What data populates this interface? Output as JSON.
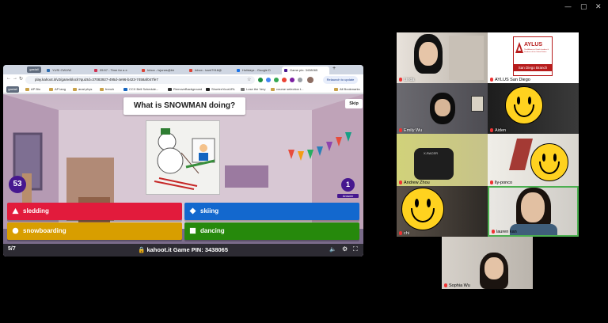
{
  "window_controls": {
    "minimize": "—",
    "maximize": "▢",
    "close": "✕"
  },
  "browser": {
    "profile_badge": "gastail",
    "tabs": [
      {
        "label": "YUSI CWJ/W",
        "color": "#2b6cb0"
      },
      {
        "label": "05:57 - Time for a e",
        "color": "#d03050"
      },
      {
        "label": "Inbox - lsjones@kh",
        "color": "#db4437"
      },
      {
        "label": "Inbox - karrl7918@",
        "color": "#db4437"
      },
      {
        "label": "Holidays - Google D",
        "color": "#1a73e8"
      },
      {
        "label": "Game pin: 3438065",
        "color": "#46178f"
      }
    ],
    "url": "play.kahoot.it/v2/gameblock?quizId=37083927-495d-4e96-b423-7458af047fe7",
    "relaunch": "Relaunch to update",
    "bookmarks": [
      "AP Bio",
      "AP lang",
      "anat phys",
      "french",
      "CCX Bell Schedule...",
      "RemoveBackground",
      "ShortenYourURL",
      "Lose the Very",
      "course selection t..."
    ],
    "all_bookmarks": "All Bookmarks"
  },
  "kahoot": {
    "question": "What is SNOWMAN doing?",
    "skip": "Skip",
    "timer": "53",
    "answers_count": "1",
    "answers_label": "Answer",
    "answers": [
      {
        "label": "sledding",
        "color": "#e21b3c",
        "shape": "triangle"
      },
      {
        "label": "skiing",
        "color": "#1368ce",
        "shape": "diamond"
      },
      {
        "label": "snowboarding",
        "color": "#d89e00",
        "shape": "circle"
      },
      {
        "label": "dancing",
        "color": "#26890c",
        "shape": "square"
      }
    ],
    "progress": "5/7",
    "site": "kahoot.it",
    "game_pin_label": "Game PIN:",
    "game_pin": "3438065"
  },
  "participants": [
    {
      "name": "Linda",
      "smiley": false
    },
    {
      "name": "AYLUS San Diego",
      "smiley": false
    },
    {
      "name": "Emily Wu",
      "smiley": false
    },
    {
      "name": "Aiden",
      "smiley": true
    },
    {
      "name": "Andrew Zhou",
      "smiley": false
    },
    {
      "name": "lly-ponco",
      "smiley": true
    },
    {
      "name": "chi",
      "smiley": true
    },
    {
      "name": "lauren kan",
      "smiley": false
    },
    {
      "name": "Sophia Wu",
      "smiley": false
    }
  ],
  "aylus_logo": {
    "name": "AYLUS",
    "tagline": "The Alliance of Youth Leaders & Students of the United States",
    "branch": "San Diego Branch"
  }
}
